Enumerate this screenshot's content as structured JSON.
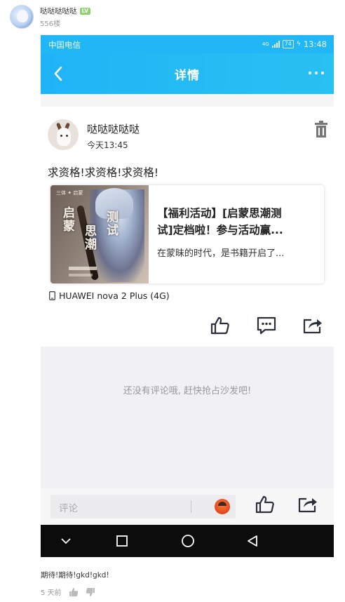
{
  "outer_post": {
    "username": "哒哒哒哒哒",
    "level_badge": "LV",
    "floor": "556楼"
  },
  "phone": {
    "status_bar": {
      "carrier": "中国电信",
      "signal_label": "4G",
      "battery": "74",
      "time": "13:48"
    },
    "app_bar": {
      "title": "详情"
    },
    "post": {
      "author": "哒哒哒哒哒",
      "time": "今天13:45",
      "text": "求资格!求资格!求资格!",
      "shared_card": {
        "thumbnail_top_text": "三体 ✦ 启蒙",
        "thumbnail_title_col1": "启蒙",
        "thumbnail_title_col2": "思潮",
        "thumbnail_title_col3": "测试",
        "title_line1": "【福利活动】[启蒙思潮测",
        "title_line2": "试]定档啦！参与活动赢...",
        "description": "在蒙昧的时代，是书籍开启了..."
      },
      "device": "HUAWEI nova 2 Plus (4G)"
    },
    "comments_empty_text": "还没有评论哦, 赶快抢占沙发吧!",
    "reply_bar": {
      "placeholder": "评论"
    }
  },
  "outer_comment": {
    "text": "期待!期待!gkd!gkd!",
    "date": "5 天前"
  },
  "colors": {
    "accent": "#21b6f5",
    "nav_bar": "#0c0c0c",
    "empty_area": "#f1f1f4",
    "level_badge": "#8fd16c"
  },
  "icons": [
    "back-arrow-icon",
    "more-dots-icon",
    "trash-icon",
    "phone-device-icon",
    "like-icon",
    "comment-icon",
    "share-icon",
    "emoji-icon",
    "nav-back-icon",
    "nav-home-icon",
    "nav-recent-icon",
    "nav-down-icon",
    "thumb-up-icon",
    "thumb-down-icon"
  ]
}
